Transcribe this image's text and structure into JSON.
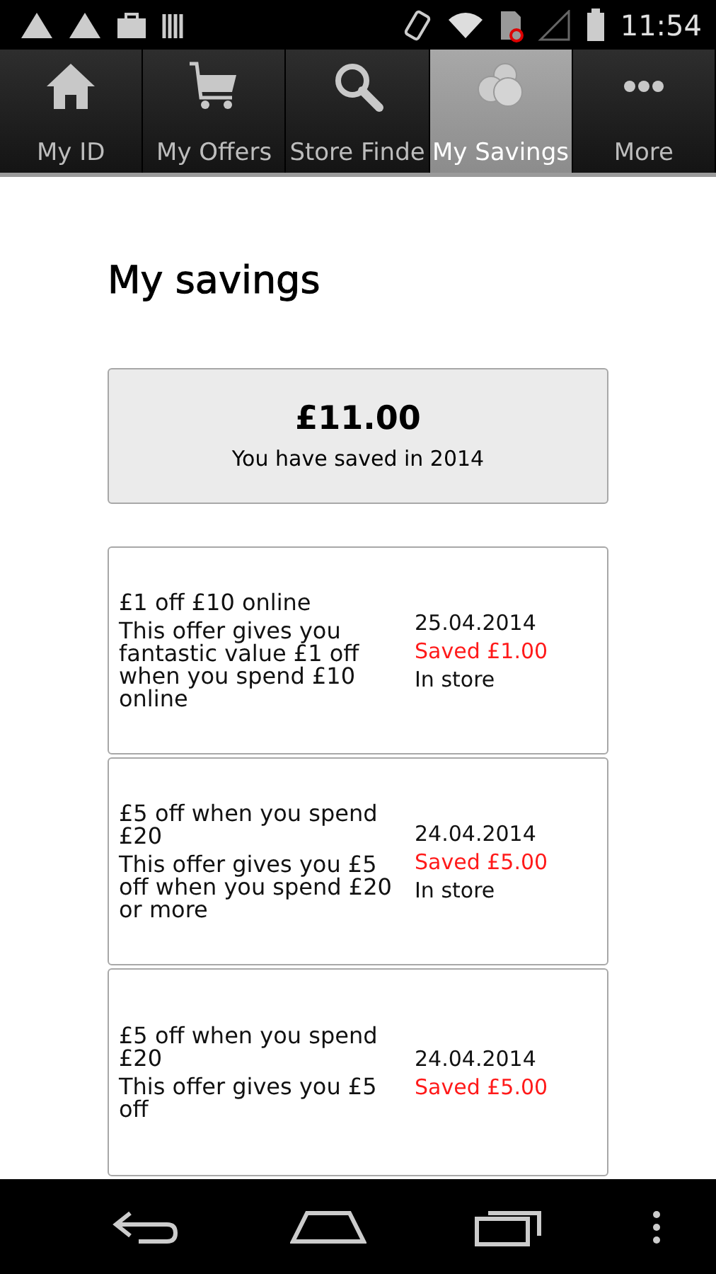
{
  "status_bar": {
    "time": "11:54"
  },
  "tabs": [
    {
      "label": "My ID",
      "kind": "home",
      "selected": false
    },
    {
      "label": "My Offers",
      "kind": "cart",
      "selected": false
    },
    {
      "label": "Store Finde",
      "kind": "search",
      "selected": false
    },
    {
      "label": "My Savings",
      "kind": "coins",
      "selected": true
    },
    {
      "label": "More",
      "kind": "more",
      "selected": false
    }
  ],
  "title": "My savings",
  "summary": {
    "amount": "£11.00",
    "caption": "You have saved in 2014"
  },
  "savings": [
    {
      "name": "£1 off £10 online",
      "description": "This offer gives you fantastic value £1 off when you spend £10 online",
      "date": "25.04.2014",
      "saved": "Saved £1.00",
      "channel": "In store"
    },
    {
      "name": "£5 off when you spend £20",
      "description": "This offer gives you £5 off when you spend £20 or more",
      "date": "24.04.2014",
      "saved": "Saved £5.00",
      "channel": "In store"
    },
    {
      "name": "£5 off when you spend £20",
      "description": "This offer gives you £5 off",
      "date": "24.04.2014",
      "saved": "Saved £5.00"
    }
  ]
}
